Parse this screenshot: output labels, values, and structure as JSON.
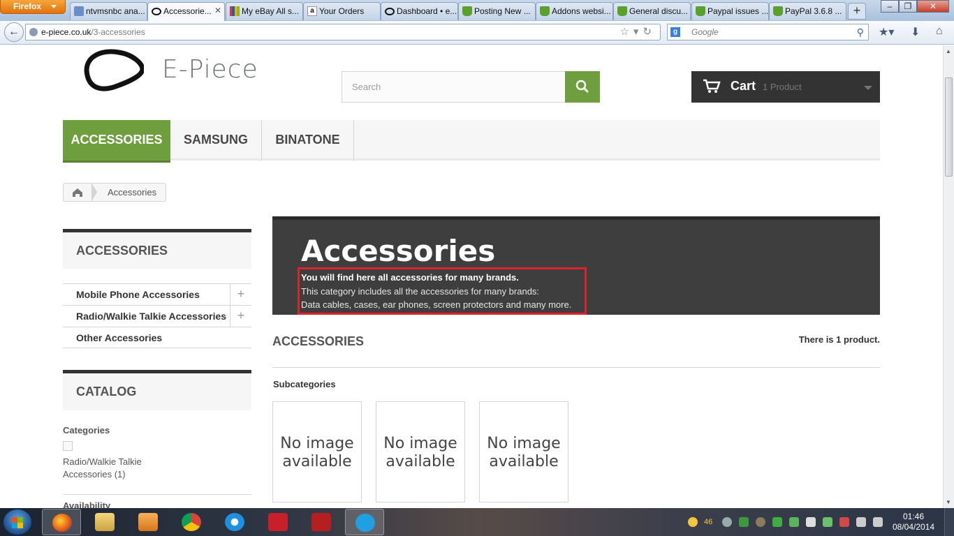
{
  "browser": {
    "app_button": "Firefox",
    "tabs": [
      {
        "label": "ntvmsnbc ana...",
        "icon": "news-icon"
      },
      {
        "label": "Accessorie...",
        "icon": "epiece-icon",
        "active": true
      },
      {
        "label": "My eBay All s...",
        "icon": "ebay-icon"
      },
      {
        "label": "Your Orders",
        "icon": "amazon-icon"
      },
      {
        "label": "Dashboard • e...",
        "icon": "epiece-icon"
      },
      {
        "label": "Posting New ...",
        "icon": "prestashop-icon"
      },
      {
        "label": "Addons websi...",
        "icon": "prestashop-icon"
      },
      {
        "label": "General discu...",
        "icon": "prestashop-icon"
      },
      {
        "label": "Paypal issues ...",
        "icon": "prestashop-icon"
      },
      {
        "label": "PayPal 3.6.8 ...",
        "icon": "prestashop-icon"
      }
    ],
    "url_domain": "e-piece.co.uk",
    "url_path": "/3-accessories",
    "search_engine_placeholder": "Google"
  },
  "site": {
    "logo_text": "E-Piece",
    "search_placeholder": "Search",
    "cart": {
      "label": "Cart",
      "quantity_text": "1 Product"
    },
    "menu": [
      "ACCESSORIES",
      "SAMSUNG",
      "BINATONE"
    ],
    "breadcrumb": {
      "current": "Accessories"
    }
  },
  "sidebar": {
    "categories_title": "ACCESSORIES",
    "categories": [
      {
        "label": "Mobile Phone Accessories",
        "expandable": true
      },
      {
        "label": "Radio/Walkie Talkie Accessories",
        "expandable": true
      },
      {
        "label": "Other Accessories",
        "expandable": false
      }
    ],
    "catalog_title": "CATALOG",
    "filters": {
      "categories_heading": "Categories",
      "category_option": "Radio/Walkie Talkie Accessories (1)",
      "availability_heading": "Availability"
    }
  },
  "main": {
    "banner_title": "Accessories",
    "description_bold": "You will find here all accessories for many brands.",
    "description_line1": "This category includes all the accessories for many brands:",
    "description_line2": "Data cables, cases, ear phones, screen protectors and many more.",
    "category_name": "ACCESSORIES",
    "product_count": "There is 1 product.",
    "subcategories_heading": "Subcategories",
    "subcategory_tiles": [
      "No image available",
      "No image available",
      "No image available"
    ]
  },
  "taskbar": {
    "tray_count": "46",
    "time": "01:46",
    "date": "08/04/2014"
  },
  "colors": {
    "accent_green": "#6f9e3e",
    "dark_banner": "#3e3e3e",
    "highlight_red": "#e0212b"
  }
}
